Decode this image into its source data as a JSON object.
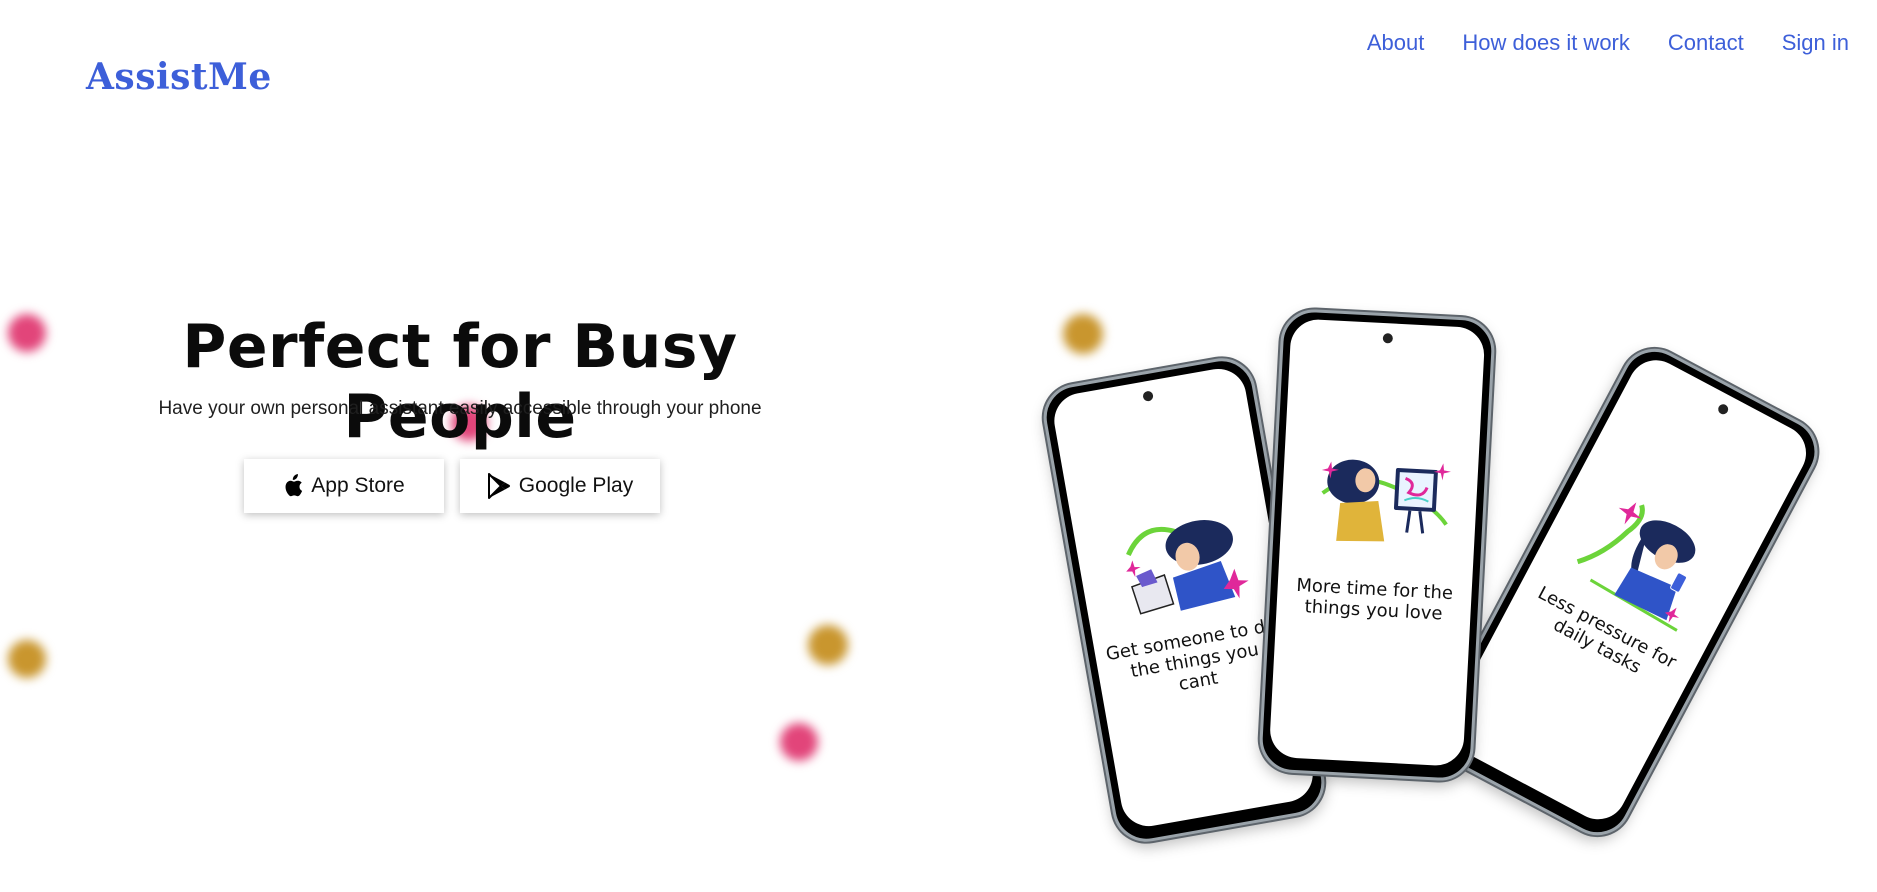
{
  "brand": {
    "name": "AssistMe"
  },
  "nav": {
    "items": [
      {
        "label": "About"
      },
      {
        "label": "How does it work"
      },
      {
        "label": "Contact"
      },
      {
        "label": "Sign in"
      }
    ]
  },
  "hero": {
    "title": "Perfect for Busy People",
    "subtitle": "Have your own personal assistant easily accessible through your phone",
    "buttons": {
      "app_store": {
        "label": "App Store",
        "icon": "apple-icon"
      },
      "google_play": {
        "label": "Google Play",
        "icon": "google-play-icon"
      }
    }
  },
  "phones": {
    "left": {
      "caption": "Get someone to do the things you cant"
    },
    "middle": {
      "caption": "More time for the things you love"
    },
    "right": {
      "caption": "Less pressure for daily tasks"
    }
  },
  "colors": {
    "brand": "#3d5fd9",
    "dot_pink": "#e2457a",
    "dot_gold": "#c9962e"
  }
}
